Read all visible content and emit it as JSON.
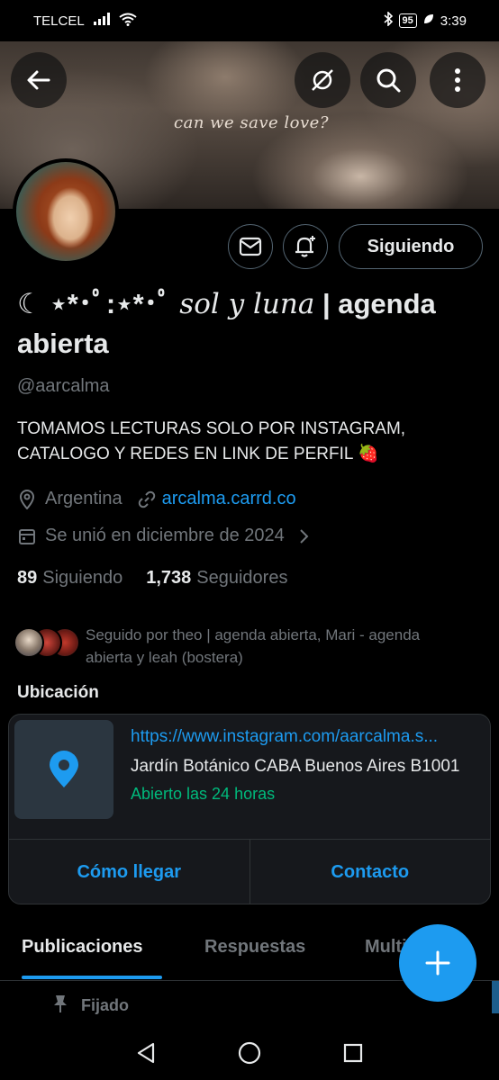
{
  "status_bar": {
    "carrier": "TELCEL",
    "battery": "95",
    "time": "3:39"
  },
  "banner": {
    "text": "can we save love?"
  },
  "profile": {
    "name_prefix": "☾ ⋆*･ﾟ:⋆*･ﾟ ",
    "name_script": "sol y luna",
    "name_suffix": " | agenda abierta",
    "handle": "@aarcalma",
    "bio": "TOMAMOS LECTURAS SOLO POR INSTAGRAM, CATALOGO Y REDES EN LINK DE PERFIL 🍓",
    "location": "Argentina",
    "website": "arcalma.carrd.co",
    "joined": "Se unió en diciembre de 2024",
    "following_count": "89",
    "following_label": "Siguiendo",
    "followers_count": "1,738",
    "followers_label": "Seguidores",
    "followed_by": "Seguido por theo | agenda abierta, Mari - agenda abierta y leah (bostera)"
  },
  "buttons": {
    "following": "Siguiendo"
  },
  "location_section": {
    "title": "Ubicación",
    "url": "https://www.instagram.com/aarcalma.s...",
    "address": "Jardín Botánico CABA Buenos Aires B1001",
    "hours": "Abierto las 24 horas",
    "directions_label": "Cómo llegar",
    "contact_label": "Contacto"
  },
  "tabs": [
    "Publicaciones",
    "Respuestas",
    "Multimedia"
  ],
  "pinned_label": "Fijado",
  "colors": {
    "accent": "#1d9bf0",
    "open_green": "#00ba7c",
    "muted": "#71767b"
  }
}
